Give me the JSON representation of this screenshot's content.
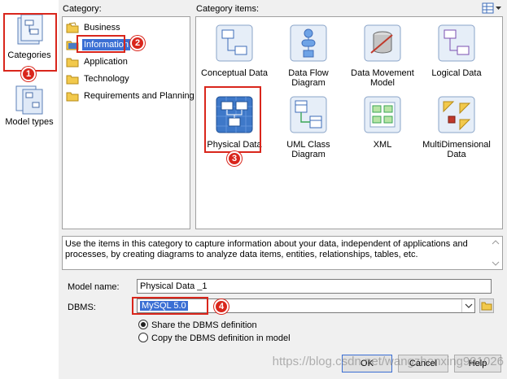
{
  "sidebar": {
    "items": [
      {
        "label": "Categories",
        "icon": "categories-icon",
        "selected": true
      },
      {
        "label": "Model types",
        "icon": "model-types-icon",
        "selected": false
      }
    ]
  },
  "category": {
    "header": "Category:",
    "items": [
      {
        "label": "Business",
        "selected": false
      },
      {
        "label": "Information",
        "selected": true
      },
      {
        "label": "Application",
        "selected": false
      },
      {
        "label": "Technology",
        "selected": false
      },
      {
        "label": "Requirements and Planning",
        "selected": false
      }
    ]
  },
  "category_items": {
    "header": "Category items:",
    "view_icon": "view-options-icon",
    "items": [
      {
        "label": "Conceptual Data",
        "icon": "conceptual-data-icon"
      },
      {
        "label": "Data Flow Diagram",
        "icon": "data-flow-diagram-icon"
      },
      {
        "label": "Data Movement Model",
        "icon": "data-movement-model-icon"
      },
      {
        "label": "Logical Data",
        "icon": "logical-data-icon"
      },
      {
        "label": "Physical Data",
        "icon": "physical-data-icon",
        "selected": true
      },
      {
        "label": "UML Class Diagram",
        "icon": "uml-class-diagram-icon"
      },
      {
        "label": "XML",
        "icon": "xml-icon"
      },
      {
        "label": "MultiDimensional Data",
        "icon": "multidimensional-data-icon"
      }
    ]
  },
  "description": "Use the items in this category to capture information about your data, independent of applications and processes, by creating diagrams to analyze data items, entities, relationships, tables, etc.",
  "form": {
    "model_name_label": "Model name:",
    "model_name_value": "Physical Data _1",
    "dbms_label": "DBMS:",
    "dbms_value": "MySQL 5.0",
    "radio_share": "Share the DBMS definition",
    "radio_copy": "Copy the DBMS definition in model"
  },
  "buttons": {
    "ok": "OK",
    "cancel": "Cancel",
    "help": "Help"
  },
  "annotations": {
    "n1": "1",
    "n2": "2",
    "n3": "3",
    "n4": "4"
  },
  "watermark": "https://blog.csdn.net/wangzhonxing991026",
  "colors": {
    "annotation_red": "#d9261c",
    "selection_blue": "#3b6fd4"
  }
}
